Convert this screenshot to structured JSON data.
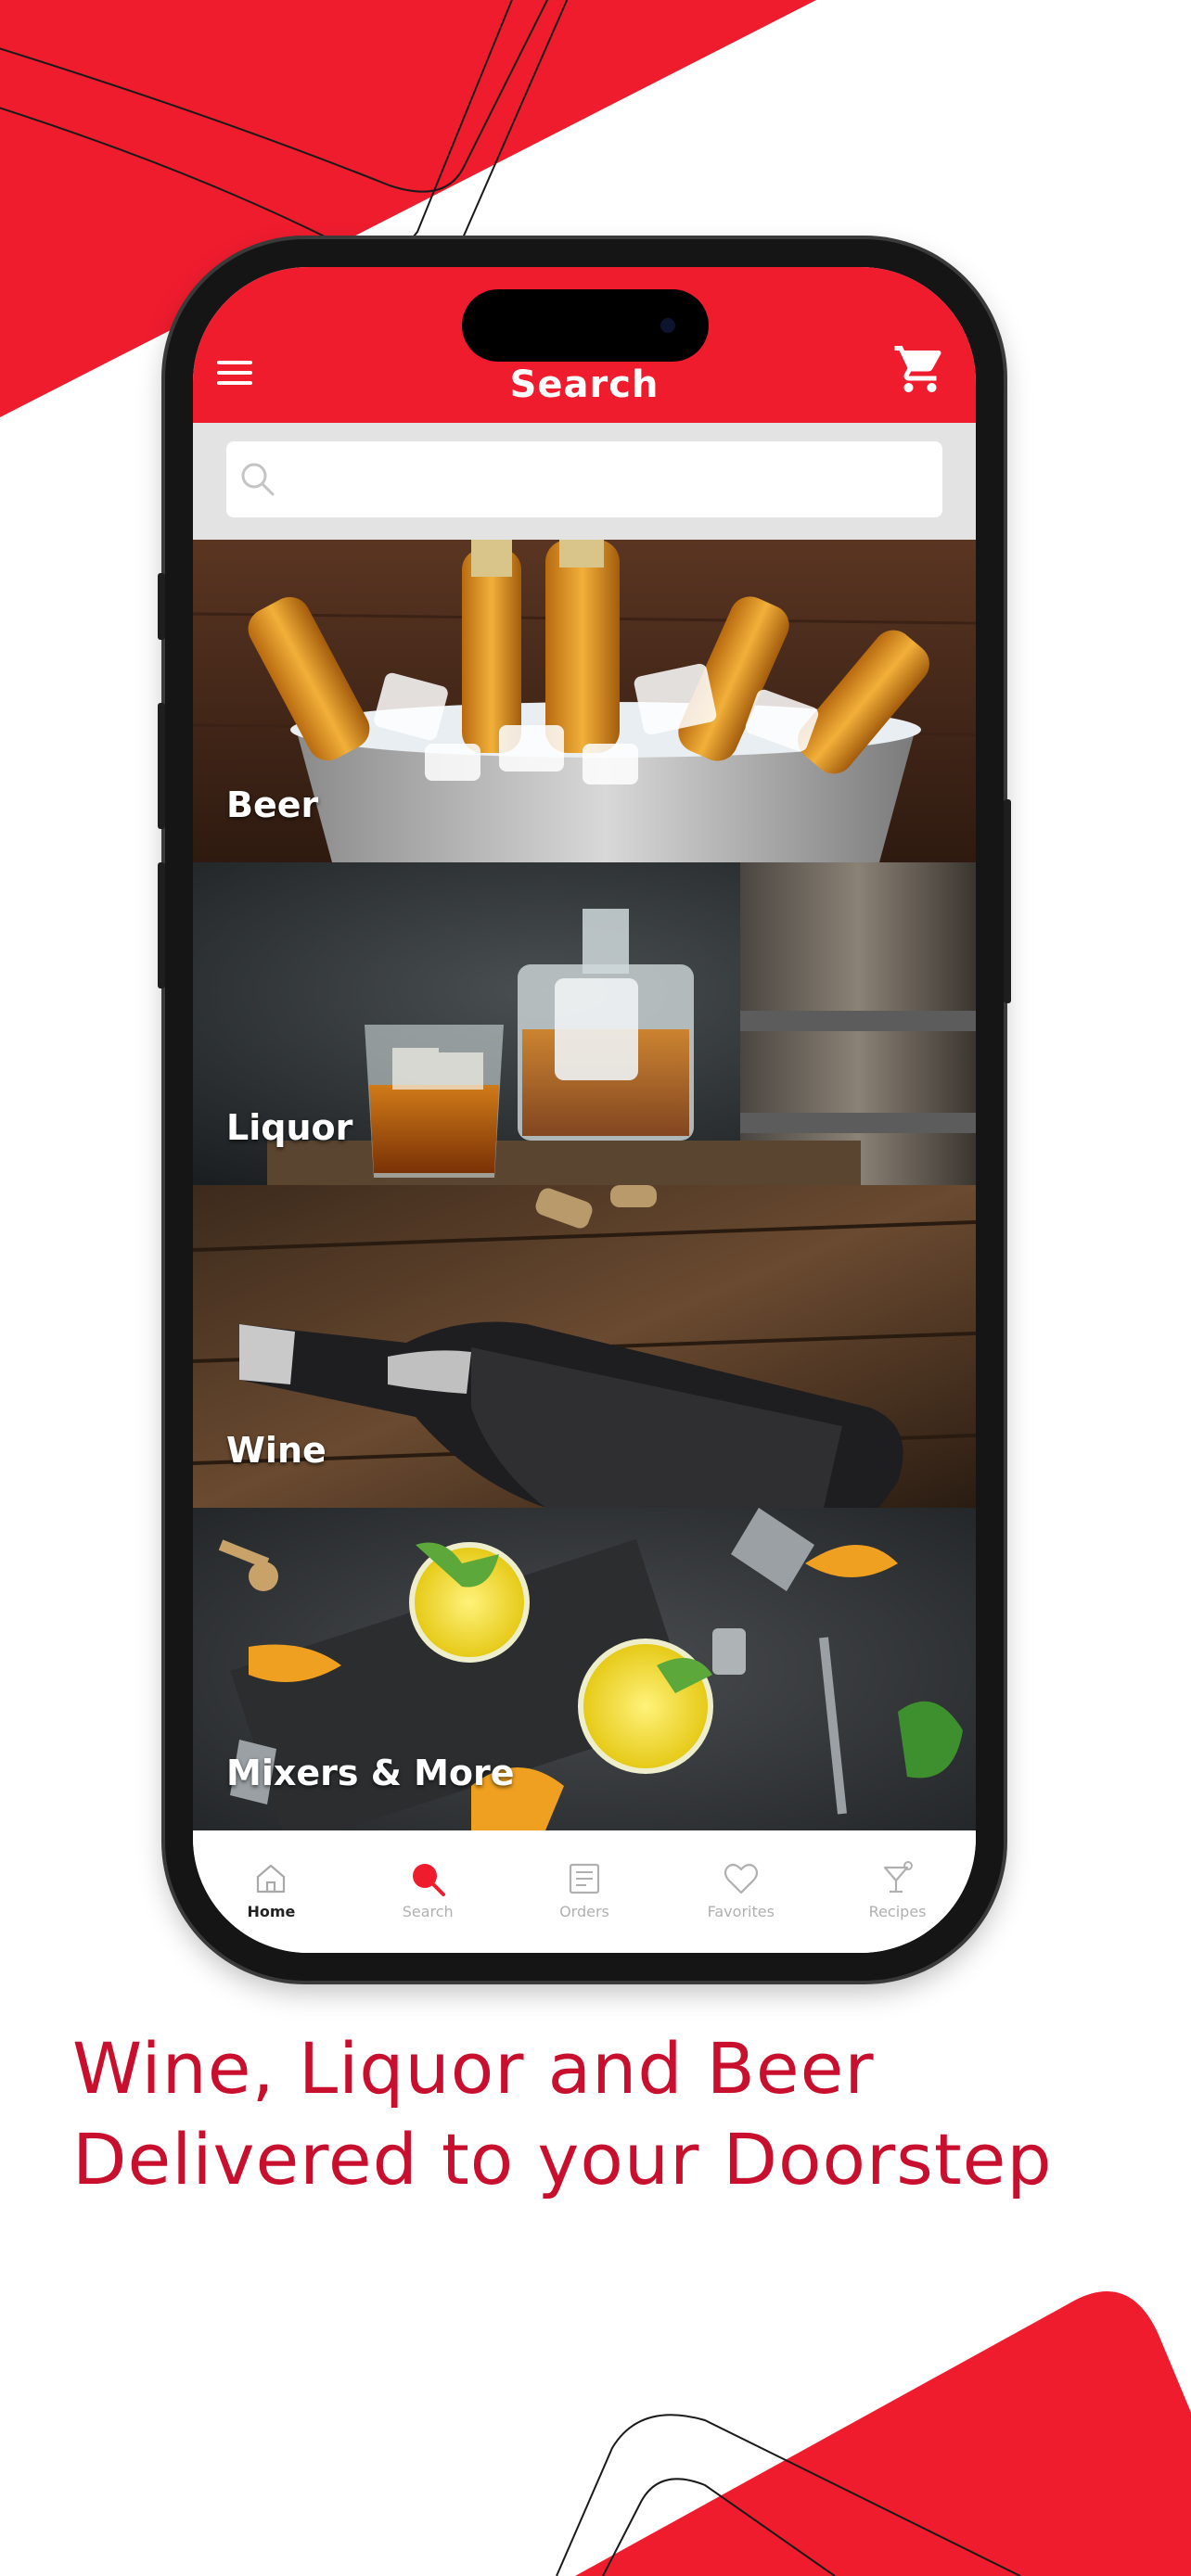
{
  "colors": {
    "brand_red": "#ef1c2e",
    "tagline_red": "#c8102e",
    "search_bg": "#e3e3e3"
  },
  "header": {
    "title": "Search",
    "menu_icon": "hamburger-menu-icon",
    "cart_icon": "shopping-cart-icon"
  },
  "search": {
    "placeholder": "",
    "value": "",
    "icon": "magnifier-icon"
  },
  "categories": [
    {
      "label": "Beer"
    },
    {
      "label": "Liquor"
    },
    {
      "label": "Wine"
    },
    {
      "label": "Mixers & More"
    }
  ],
  "tabbar": {
    "items": [
      {
        "label": "Home",
        "icon": "house-icon",
        "state": "active"
      },
      {
        "label": "Search",
        "icon": "search-icon",
        "state": "highlighted"
      },
      {
        "label": "Orders",
        "icon": "orders-list-icon",
        "state": "inactive"
      },
      {
        "label": "Favorites",
        "icon": "heart-icon",
        "state": "inactive"
      },
      {
        "label": "Recipes",
        "icon": "cocktail-glass-icon",
        "state": "inactive"
      }
    ]
  },
  "tagline": {
    "line1": "Wine, Liquor and Beer",
    "line2": "Delivered to your Doorstep"
  }
}
